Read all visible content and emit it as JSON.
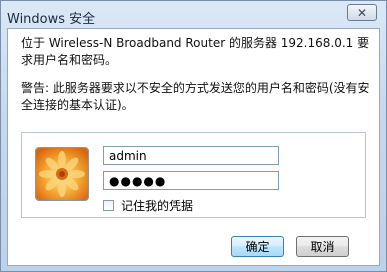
{
  "window": {
    "title": "Windows 安全",
    "close_glyph": "✕"
  },
  "messages": {
    "line1": "位于 Wireless-N Broadband Router 的服务器 192.168.0.1 要求用户名和密码。",
    "line2": "警告: 此服务器要求以不安全的方式发送您的用户名和密码(没有安全连接的基本认证)。"
  },
  "credentials": {
    "username_value": "admin",
    "password_value": "●●●●●",
    "remember_label": "记住我的凭据",
    "remember_checked": false
  },
  "buttons": {
    "ok_label": "确定",
    "cancel_label": "取消"
  },
  "colors": {
    "accent": "#3c7fb1",
    "avatar_orange": "#f39a1c"
  },
  "icons": {
    "avatar": "user-avatar-flower-icon",
    "close": "close-icon"
  }
}
